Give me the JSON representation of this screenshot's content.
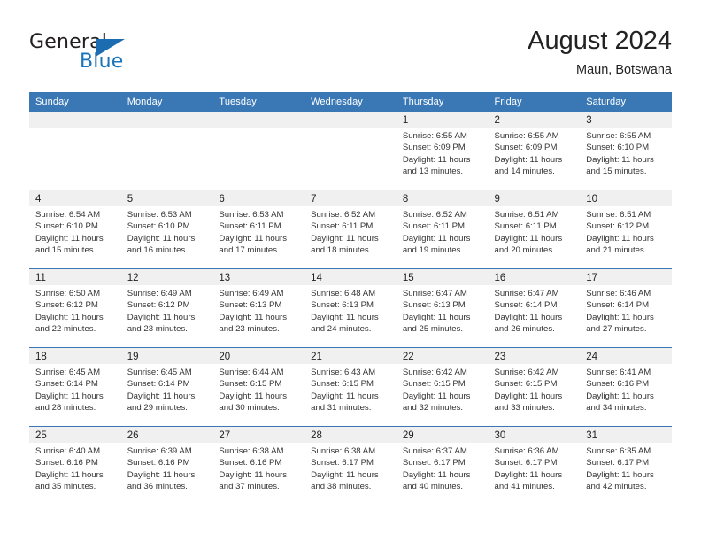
{
  "brand": {
    "name_part1": "General",
    "name_part2": "Blue",
    "triangle_color": "#1b6cb0",
    "blue_text_color": "#1b75bb"
  },
  "header": {
    "title": "August 2024",
    "subtitle": "Maun, Botswana"
  },
  "theme": {
    "header_bar_color": "#3a78b5",
    "day_band_color": "#f0f0f0",
    "row_separator_color": "#3a78b5",
    "text_color": "#333333"
  },
  "weekdays": [
    "Sunday",
    "Monday",
    "Tuesday",
    "Wednesday",
    "Thursday",
    "Friday",
    "Saturday"
  ],
  "weeks": [
    [
      {
        "day": "",
        "sunrise": "",
        "sunset": "",
        "daylight1": "",
        "daylight2": ""
      },
      {
        "day": "",
        "sunrise": "",
        "sunset": "",
        "daylight1": "",
        "daylight2": ""
      },
      {
        "day": "",
        "sunrise": "",
        "sunset": "",
        "daylight1": "",
        "daylight2": ""
      },
      {
        "day": "",
        "sunrise": "",
        "sunset": "",
        "daylight1": "",
        "daylight2": ""
      },
      {
        "day": "1",
        "sunrise": "Sunrise: 6:55 AM",
        "sunset": "Sunset: 6:09 PM",
        "daylight1": "Daylight: 11 hours",
        "daylight2": "and 13 minutes."
      },
      {
        "day": "2",
        "sunrise": "Sunrise: 6:55 AM",
        "sunset": "Sunset: 6:09 PM",
        "daylight1": "Daylight: 11 hours",
        "daylight2": "and 14 minutes."
      },
      {
        "day": "3",
        "sunrise": "Sunrise: 6:55 AM",
        "sunset": "Sunset: 6:10 PM",
        "daylight1": "Daylight: 11 hours",
        "daylight2": "and 15 minutes."
      }
    ],
    [
      {
        "day": "4",
        "sunrise": "Sunrise: 6:54 AM",
        "sunset": "Sunset: 6:10 PM",
        "daylight1": "Daylight: 11 hours",
        "daylight2": "and 15 minutes."
      },
      {
        "day": "5",
        "sunrise": "Sunrise: 6:53 AM",
        "sunset": "Sunset: 6:10 PM",
        "daylight1": "Daylight: 11 hours",
        "daylight2": "and 16 minutes."
      },
      {
        "day": "6",
        "sunrise": "Sunrise: 6:53 AM",
        "sunset": "Sunset: 6:11 PM",
        "daylight1": "Daylight: 11 hours",
        "daylight2": "and 17 minutes."
      },
      {
        "day": "7",
        "sunrise": "Sunrise: 6:52 AM",
        "sunset": "Sunset: 6:11 PM",
        "daylight1": "Daylight: 11 hours",
        "daylight2": "and 18 minutes."
      },
      {
        "day": "8",
        "sunrise": "Sunrise: 6:52 AM",
        "sunset": "Sunset: 6:11 PM",
        "daylight1": "Daylight: 11 hours",
        "daylight2": "and 19 minutes."
      },
      {
        "day": "9",
        "sunrise": "Sunrise: 6:51 AM",
        "sunset": "Sunset: 6:11 PM",
        "daylight1": "Daylight: 11 hours",
        "daylight2": "and 20 minutes."
      },
      {
        "day": "10",
        "sunrise": "Sunrise: 6:51 AM",
        "sunset": "Sunset: 6:12 PM",
        "daylight1": "Daylight: 11 hours",
        "daylight2": "and 21 minutes."
      }
    ],
    [
      {
        "day": "11",
        "sunrise": "Sunrise: 6:50 AM",
        "sunset": "Sunset: 6:12 PM",
        "daylight1": "Daylight: 11 hours",
        "daylight2": "and 22 minutes."
      },
      {
        "day": "12",
        "sunrise": "Sunrise: 6:49 AM",
        "sunset": "Sunset: 6:12 PM",
        "daylight1": "Daylight: 11 hours",
        "daylight2": "and 23 minutes."
      },
      {
        "day": "13",
        "sunrise": "Sunrise: 6:49 AM",
        "sunset": "Sunset: 6:13 PM",
        "daylight1": "Daylight: 11 hours",
        "daylight2": "and 23 minutes."
      },
      {
        "day": "14",
        "sunrise": "Sunrise: 6:48 AM",
        "sunset": "Sunset: 6:13 PM",
        "daylight1": "Daylight: 11 hours",
        "daylight2": "and 24 minutes."
      },
      {
        "day": "15",
        "sunrise": "Sunrise: 6:47 AM",
        "sunset": "Sunset: 6:13 PM",
        "daylight1": "Daylight: 11 hours",
        "daylight2": "and 25 minutes."
      },
      {
        "day": "16",
        "sunrise": "Sunrise: 6:47 AM",
        "sunset": "Sunset: 6:14 PM",
        "daylight1": "Daylight: 11 hours",
        "daylight2": "and 26 minutes."
      },
      {
        "day": "17",
        "sunrise": "Sunrise: 6:46 AM",
        "sunset": "Sunset: 6:14 PM",
        "daylight1": "Daylight: 11 hours",
        "daylight2": "and 27 minutes."
      }
    ],
    [
      {
        "day": "18",
        "sunrise": "Sunrise: 6:45 AM",
        "sunset": "Sunset: 6:14 PM",
        "daylight1": "Daylight: 11 hours",
        "daylight2": "and 28 minutes."
      },
      {
        "day": "19",
        "sunrise": "Sunrise: 6:45 AM",
        "sunset": "Sunset: 6:14 PM",
        "daylight1": "Daylight: 11 hours",
        "daylight2": "and 29 minutes."
      },
      {
        "day": "20",
        "sunrise": "Sunrise: 6:44 AM",
        "sunset": "Sunset: 6:15 PM",
        "daylight1": "Daylight: 11 hours",
        "daylight2": "and 30 minutes."
      },
      {
        "day": "21",
        "sunrise": "Sunrise: 6:43 AM",
        "sunset": "Sunset: 6:15 PM",
        "daylight1": "Daylight: 11 hours",
        "daylight2": "and 31 minutes."
      },
      {
        "day": "22",
        "sunrise": "Sunrise: 6:42 AM",
        "sunset": "Sunset: 6:15 PM",
        "daylight1": "Daylight: 11 hours",
        "daylight2": "and 32 minutes."
      },
      {
        "day": "23",
        "sunrise": "Sunrise: 6:42 AM",
        "sunset": "Sunset: 6:15 PM",
        "daylight1": "Daylight: 11 hours",
        "daylight2": "and 33 minutes."
      },
      {
        "day": "24",
        "sunrise": "Sunrise: 6:41 AM",
        "sunset": "Sunset: 6:16 PM",
        "daylight1": "Daylight: 11 hours",
        "daylight2": "and 34 minutes."
      }
    ],
    [
      {
        "day": "25",
        "sunrise": "Sunrise: 6:40 AM",
        "sunset": "Sunset: 6:16 PM",
        "daylight1": "Daylight: 11 hours",
        "daylight2": "and 35 minutes."
      },
      {
        "day": "26",
        "sunrise": "Sunrise: 6:39 AM",
        "sunset": "Sunset: 6:16 PM",
        "daylight1": "Daylight: 11 hours",
        "daylight2": "and 36 minutes."
      },
      {
        "day": "27",
        "sunrise": "Sunrise: 6:38 AM",
        "sunset": "Sunset: 6:16 PM",
        "daylight1": "Daylight: 11 hours",
        "daylight2": "and 37 minutes."
      },
      {
        "day": "28",
        "sunrise": "Sunrise: 6:38 AM",
        "sunset": "Sunset: 6:17 PM",
        "daylight1": "Daylight: 11 hours",
        "daylight2": "and 38 minutes."
      },
      {
        "day": "29",
        "sunrise": "Sunrise: 6:37 AM",
        "sunset": "Sunset: 6:17 PM",
        "daylight1": "Daylight: 11 hours",
        "daylight2": "and 40 minutes."
      },
      {
        "day": "30",
        "sunrise": "Sunrise: 6:36 AM",
        "sunset": "Sunset: 6:17 PM",
        "daylight1": "Daylight: 11 hours",
        "daylight2": "and 41 minutes."
      },
      {
        "day": "31",
        "sunrise": "Sunrise: 6:35 AM",
        "sunset": "Sunset: 6:17 PM",
        "daylight1": "Daylight: 11 hours",
        "daylight2": "and 42 minutes."
      }
    ]
  ]
}
